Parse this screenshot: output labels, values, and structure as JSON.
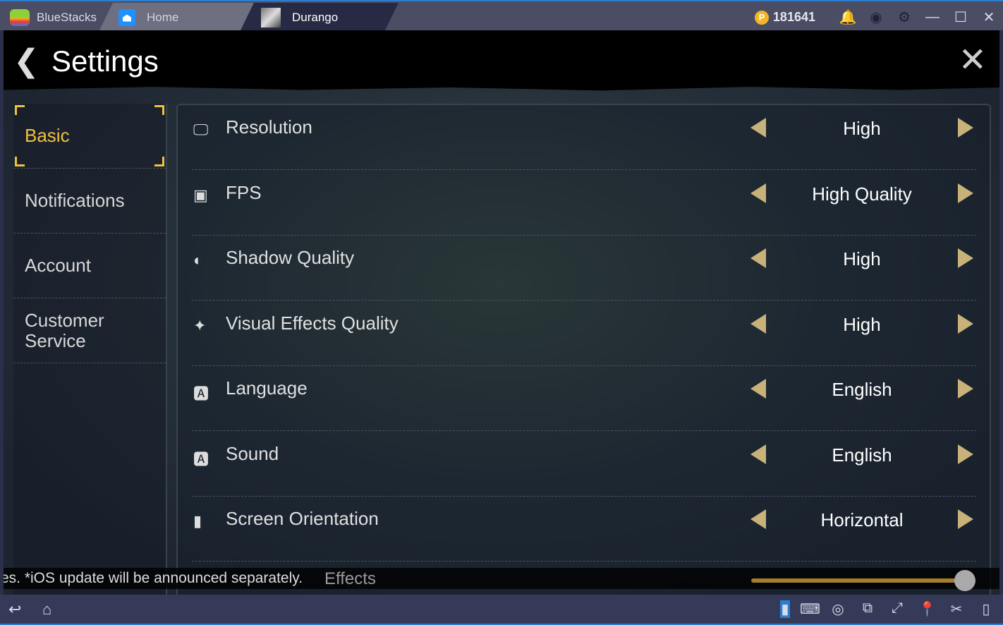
{
  "titlebar": {
    "app": "BlueStacks",
    "tabs": [
      {
        "label": "Home"
      },
      {
        "label": "Durango"
      }
    ],
    "points": "181641",
    "accent": "#2a7fd0"
  },
  "settings": {
    "title": "Settings",
    "sidebar": [
      {
        "label": "Basic",
        "active": true
      },
      {
        "label": "Notifications"
      },
      {
        "label": "Account"
      },
      {
        "label": "Customer Service"
      }
    ],
    "rows": [
      {
        "label": "Resolution",
        "value": "High",
        "icon": "monitor-icon"
      },
      {
        "label": "FPS",
        "value": "High Quality",
        "icon": "fps-icon"
      },
      {
        "label": "Shadow Quality",
        "value": "High",
        "icon": "shadow-icon"
      },
      {
        "label": "Visual Effects Quality",
        "value": "High",
        "icon": "sparkle-icon"
      },
      {
        "label": "Language",
        "value": "English",
        "icon": "language-icon"
      },
      {
        "label": "Sound",
        "value": "English",
        "icon": "language-icon"
      },
      {
        "label": "Screen Orientation",
        "value": "Horizontal",
        "icon": "orientation-icon"
      }
    ],
    "partial_row": "Effects"
  },
  "ticker": "es. *iOS update will be announced separately."
}
